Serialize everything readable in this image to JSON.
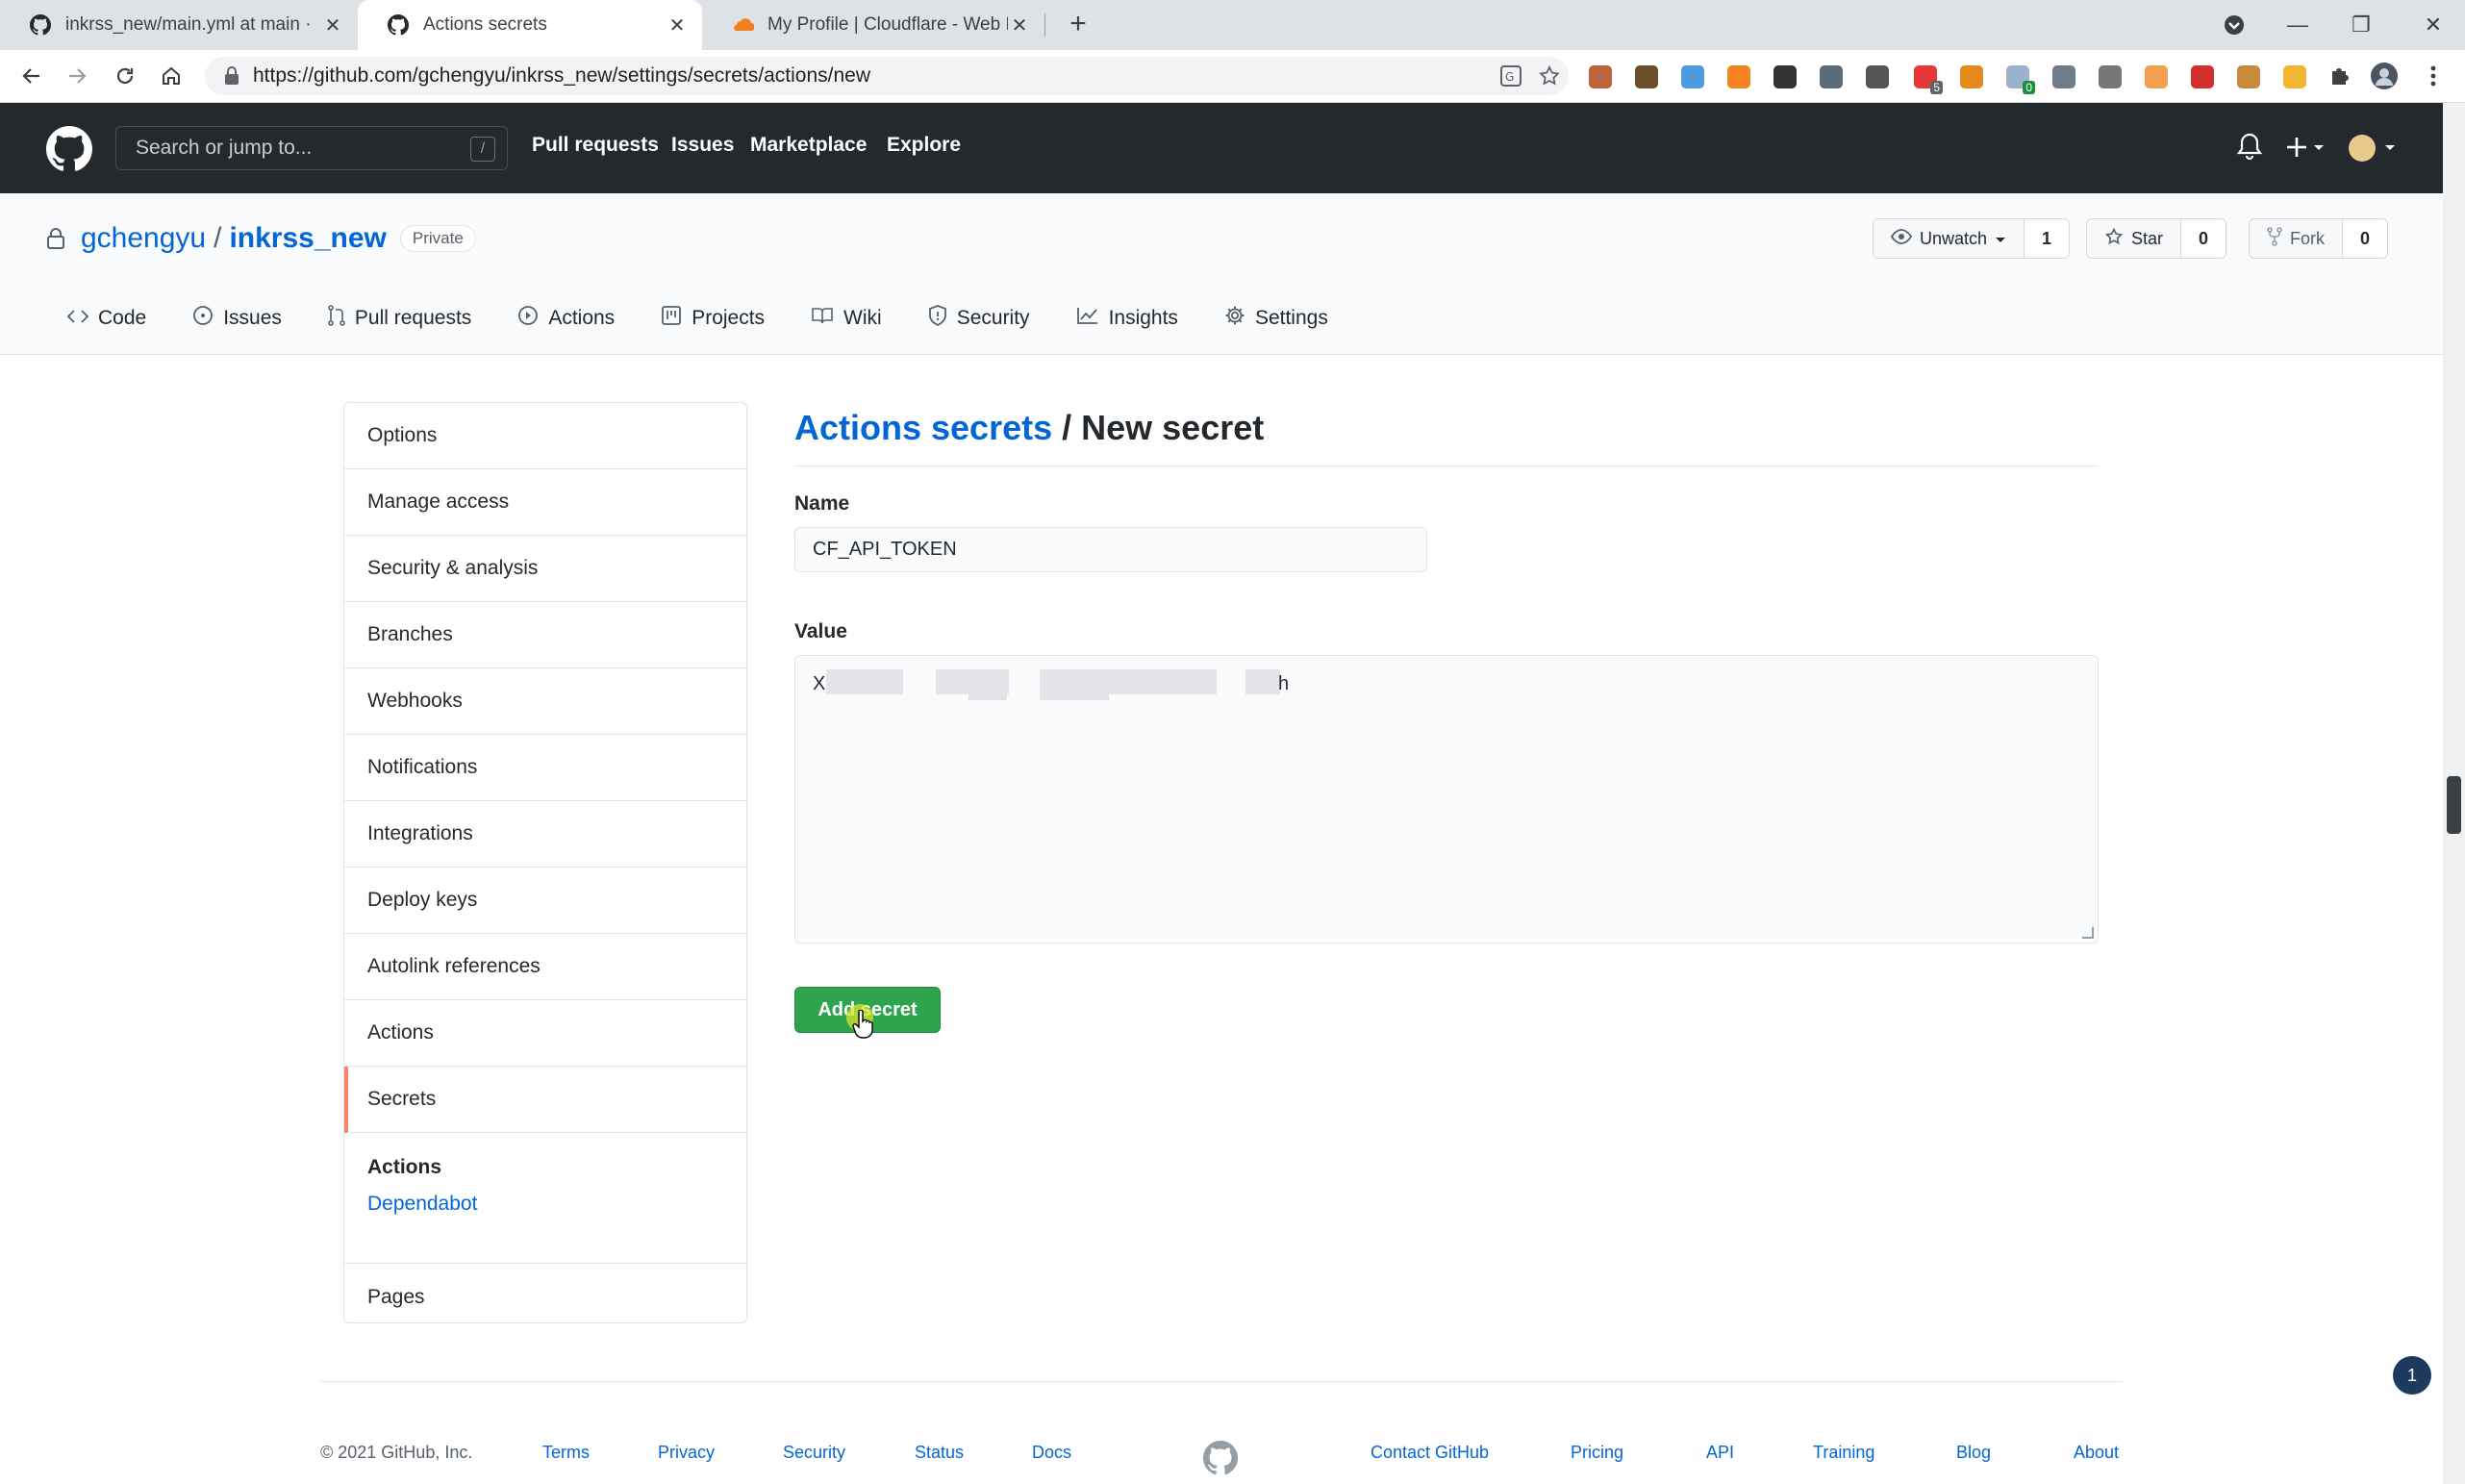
{
  "browser": {
    "tabs": [
      {
        "title": "inkrss_new/main.yml at main ·",
        "active": false
      },
      {
        "title": "Actions secrets",
        "active": true
      },
      {
        "title": "My Profile | Cloudflare - Web P",
        "active": false
      }
    ],
    "url": "https://github.com/gchengyu/inkrss_new/settings/secrets/actions/new",
    "extensions": [
      {
        "name": "ext-1",
        "color": "#c0623a"
      },
      {
        "name": "ext-2",
        "color": "#6b4f2a"
      },
      {
        "name": "ext-3",
        "color": "#4a9be0"
      },
      {
        "name": "ext-4",
        "color": "#f58220"
      },
      {
        "name": "ext-5",
        "color": "#333333"
      },
      {
        "name": "ext-6",
        "color": "#5a6b7a"
      },
      {
        "name": "ext-7",
        "color": "#555555"
      },
      {
        "name": "ext-8",
        "color": "#e53935",
        "badge": "5"
      },
      {
        "name": "ext-9",
        "color": "#e58a1f"
      },
      {
        "name": "ext-10",
        "color": "#9ab3c8",
        "badge": "0"
      },
      {
        "name": "ext-11",
        "color": "#6f7c8a"
      },
      {
        "name": "ext-12",
        "color": "#777777"
      },
      {
        "name": "ext-13",
        "color": "#f0a050"
      },
      {
        "name": "ext-14",
        "color": "#d32f2f"
      },
      {
        "name": "ext-15",
        "color": "#c98a3b"
      },
      {
        "name": "ext-16",
        "color": "#f2b632"
      }
    ]
  },
  "gh_header": {
    "search_placeholder": "Search or jump to...",
    "search_key": "/",
    "nav": [
      "Pull requests",
      "Issues",
      "Marketplace",
      "Explore"
    ]
  },
  "repo": {
    "owner": "gchengyu",
    "separator": "/",
    "name": "inkrss_new",
    "visibility": "Private",
    "watch_label": "Unwatch",
    "watch_count": "1",
    "star_label": "Star",
    "star_count": "0",
    "fork_label": "Fork",
    "fork_count": "0",
    "tabs": [
      "Code",
      "Issues",
      "Pull requests",
      "Actions",
      "Projects",
      "Wiki",
      "Security",
      "Insights",
      "Settings"
    ]
  },
  "sidebar": {
    "items": [
      "Options",
      "Manage access",
      "Security & analysis",
      "Branches",
      "Webhooks",
      "Notifications",
      "Integrations",
      "Deploy keys",
      "Autolink references",
      "Actions",
      "Secrets"
    ],
    "group_heading": "Actions",
    "group_link": "Dependabot",
    "last_item": "Pages"
  },
  "main": {
    "title_link": "Actions secrets",
    "title_rest": " / New secret",
    "name_label": "Name",
    "name_value": "CF_API_TOKEN",
    "value_label": "Value",
    "value_first": "X",
    "value_last": "h",
    "submit_label": "Add secret"
  },
  "footer": {
    "copyright": "© 2021 GitHub, Inc.",
    "left_links": [
      "Terms",
      "Privacy",
      "Security",
      "Status",
      "Docs"
    ],
    "right_links": [
      "Contact GitHub",
      "Pricing",
      "API",
      "Training",
      "Blog",
      "About"
    ]
  },
  "notification_count": "1",
  "colors": {
    "header_bg": "#24292e",
    "link": "#0366d6",
    "primary_button": "#2ea44f",
    "selected_accent": "#f9826c"
  }
}
